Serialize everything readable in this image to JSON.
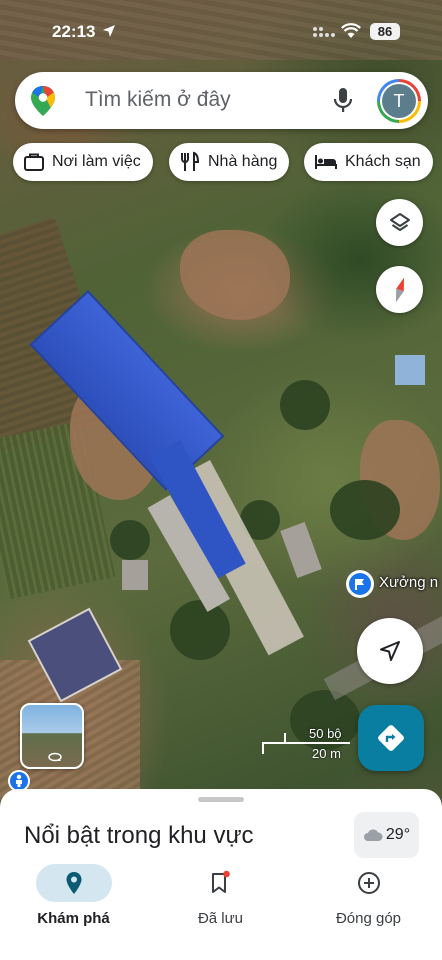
{
  "status_bar": {
    "time": "22:13",
    "battery": "86"
  },
  "search": {
    "placeholder": "Tìm kiếm ở đây",
    "avatar_initial": "T"
  },
  "chips": [
    {
      "label": "Nơi làm việc",
      "icon": "briefcase-icon"
    },
    {
      "label": "Nhà hàng",
      "icon": "fork-knife-icon"
    },
    {
      "label": "Khách sạn",
      "icon": "bed-icon"
    }
  ],
  "map": {
    "place_label": "Xưởng n",
    "scale": {
      "imperial": "50 bộ",
      "metric": "20 m"
    }
  },
  "sheet": {
    "title": "Nổi bật trong khu vực",
    "weather": "29°"
  },
  "nav": [
    {
      "label": "Khám phá",
      "icon": "explore-pin-icon",
      "active": true
    },
    {
      "label": "Đã lưu",
      "icon": "bookmark-icon",
      "active": false
    },
    {
      "label": "Đóng góp",
      "icon": "plus-circle-icon",
      "active": false
    }
  ],
  "colors": {
    "accent": "#0a7ea1",
    "nav_active_pill": "#d4e6ef",
    "place_pin": "#1a73e8"
  }
}
